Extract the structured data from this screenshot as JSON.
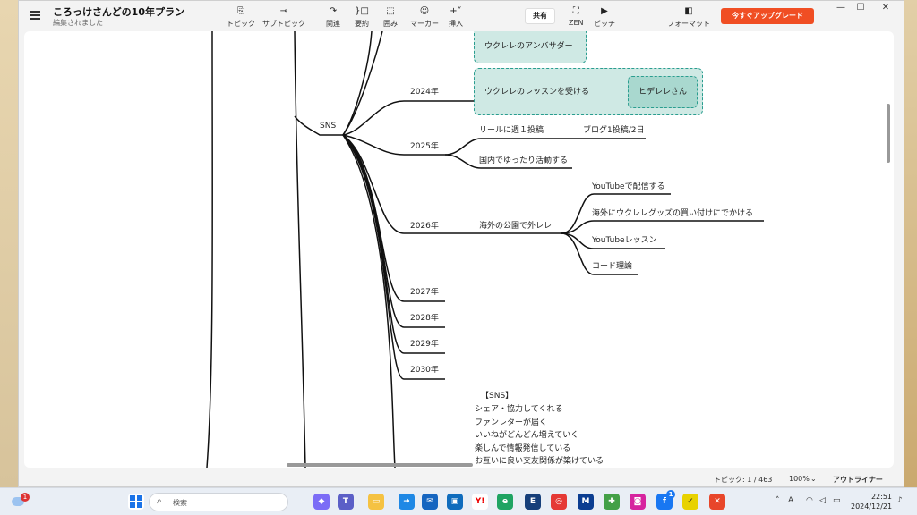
{
  "app": {
    "title": "ころっけさんどの10年プラン",
    "subtitle": "編集されました"
  },
  "toolbar": {
    "topic": "トピック",
    "subtopic": "サブトピック",
    "relation": "関連",
    "summary": "要約",
    "boundary": "囲み",
    "marker": "マーカー",
    "insert": "挿入",
    "share": "共有",
    "zen": "ZEN",
    "pitch": "ピッチ",
    "format": "フォーマット",
    "upgrade": "今すぐアップグレード"
  },
  "mindmap": {
    "sns": "SNS",
    "ambassador": "ウクレレのアンバサダー",
    "y2024": "2024年",
    "lesson": "ウクレレのレッスンを受ける",
    "hiderere": "ヒデレレさん",
    "y2025": "2025年",
    "reel": "リールに週１投稿",
    "blog": "ブログ1投稿/2日",
    "domestic": "国内でゆったり活動する",
    "y2026": "2026年",
    "overseas": "海外の公園で外レレ",
    "yt_post": "YouTubeで配信する",
    "buying": "海外にウクレレグッズの買い付けにでかける",
    "yt_lesson": "YouTubeレッスン",
    "chord": "コード理論",
    "y2027": "2027年",
    "y2028": "2028年",
    "y2029": "2029年",
    "y2030": "2030年",
    "note": [
      "【SNS】",
      "シェア・協力してくれる",
      "ファンレターが届く",
      "いいねがどんどん増えていく",
      "楽しんで情報発信している",
      "お互いに良い交友関係が築けている"
    ]
  },
  "status": {
    "topics": "トピック: 1 / 463",
    "zoom": "100%",
    "outliner": "アウトライナー"
  },
  "taskbar": {
    "search_placeholder": "検索",
    "time": "22:51",
    "date": "2024/12/21",
    "weather_badge": "1",
    "fb_badge": "1"
  }
}
